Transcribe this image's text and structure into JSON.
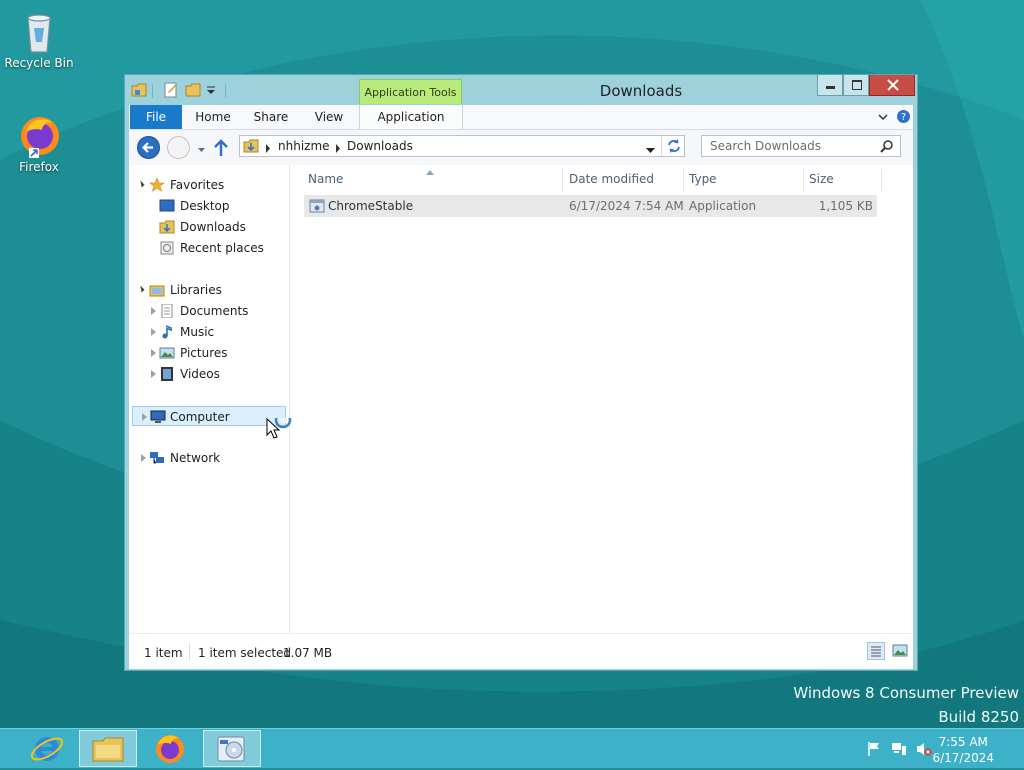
{
  "desktop": {
    "icons": [
      {
        "label": "Recycle Bin",
        "icon": "recycle-bin-icon"
      },
      {
        "label": "Firefox",
        "icon": "firefox-icon"
      }
    ],
    "watermark_line1": "Windows 8 Consumer Preview",
    "watermark_line2": "Build 8250"
  },
  "window": {
    "title": "Downloads",
    "context_tab": "Application Tools",
    "ribbon_tabs": [
      "File",
      "Home",
      "Share",
      "View",
      "Application"
    ],
    "breadcrumb": [
      "nhhizme",
      "Downloads"
    ],
    "search_placeholder": "Search Downloads",
    "nav": {
      "favorites": "Favorites",
      "desktop": "Desktop",
      "downloads": "Downloads",
      "recent": "Recent places",
      "libraries": "Libraries",
      "documents": "Documents",
      "music": "Music",
      "pictures": "Pictures",
      "videos": "Videos",
      "computer": "Computer",
      "network": "Network"
    },
    "columns": {
      "name": "Name",
      "date": "Date modified",
      "type": "Type",
      "size": "Size"
    },
    "files": [
      {
        "name": "ChromeStable",
        "date": "6/17/2024 7:54 AM",
        "type": "Application",
        "size": "1,105 KB"
      }
    ],
    "status": {
      "count": "1 item",
      "selected": "1 item selected",
      "size": "1.07 MB"
    }
  },
  "taskbar": {
    "time": "7:55 AM",
    "date": "6/17/2024",
    "pinned": [
      "internet-explorer-icon",
      "file-explorer-icon",
      "firefox-icon",
      "disc-setup-icon"
    ]
  },
  "colors": {
    "accent": "#1979ca",
    "taskbar": "#3cb1c8",
    "desktop": "#1e8f95",
    "context_tab": "#b9ea7c"
  }
}
